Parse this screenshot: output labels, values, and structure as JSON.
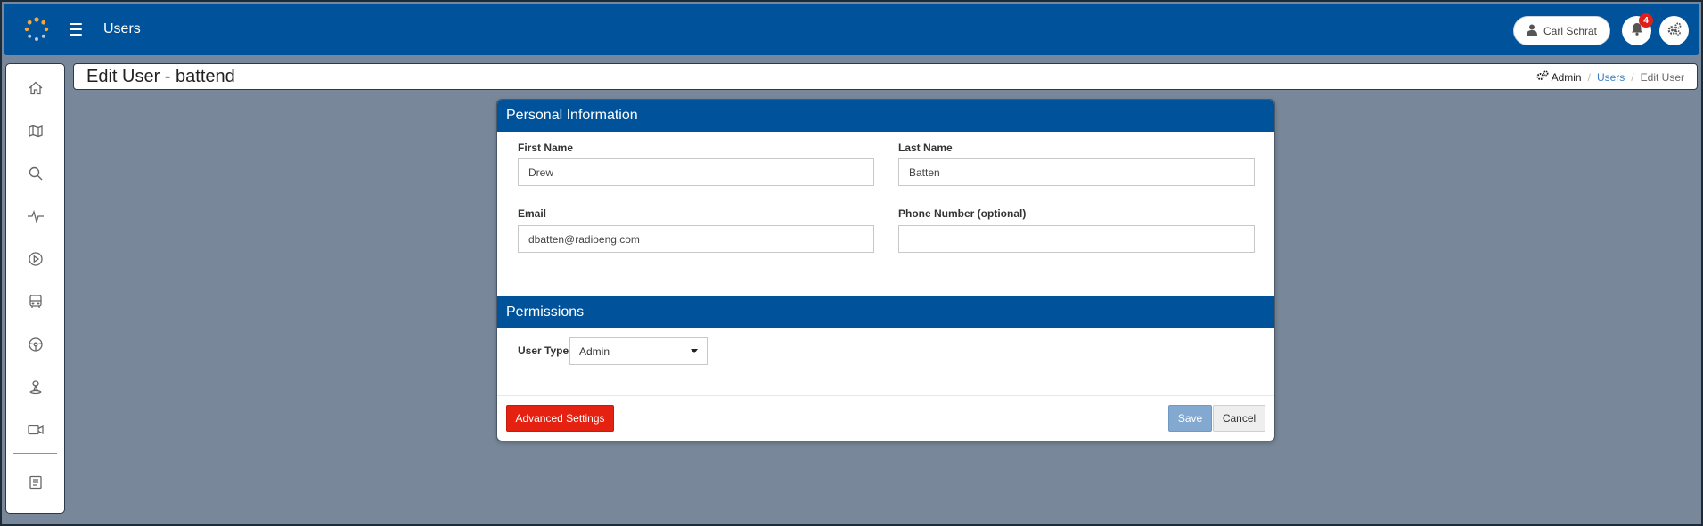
{
  "topbar": {
    "title": "Users",
    "user_name": "Carl Schrat",
    "notification_count": "4",
    "brand_color": "#00529b"
  },
  "sidebar": {
    "items": [
      {
        "icon": "home-icon"
      },
      {
        "icon": "map-icon"
      },
      {
        "icon": "search-icon"
      },
      {
        "icon": "pulse-icon"
      },
      {
        "icon": "play-icon"
      },
      {
        "icon": "bus-icon"
      },
      {
        "icon": "steering-wheel-icon"
      },
      {
        "icon": "driver-location-icon"
      },
      {
        "icon": "video-camera-icon"
      },
      {
        "icon": "book-icon"
      }
    ]
  },
  "header": {
    "page_title": "Edit User - battend",
    "breadcrumb": {
      "admin": "Admin",
      "users": "Users",
      "current": "Edit User"
    }
  },
  "form": {
    "personal_section_title": "Personal Information",
    "first_name_label": "First Name",
    "first_name_value": "Drew",
    "last_name_label": "Last Name",
    "last_name_value": "Batten",
    "email_label": "Email",
    "email_value": "dbatten@radioeng.com",
    "phone_label": "Phone Number (optional)",
    "phone_value": "",
    "permissions_section_title": "Permissions",
    "user_type_label": "User Type",
    "user_type_value": "Admin"
  },
  "actions": {
    "advanced_label": "Advanced Settings",
    "save_label": "Save",
    "cancel_label": "Cancel",
    "advanced_color": "#e52211",
    "save_color": "#84a9d0"
  }
}
